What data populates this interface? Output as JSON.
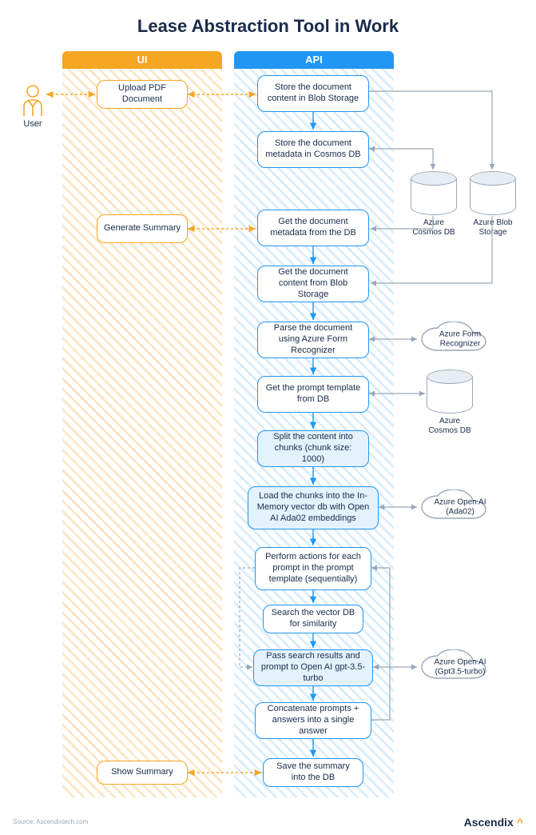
{
  "title": "Lease Abstraction Tool in Work",
  "lanes": {
    "ui": "UI",
    "api": "API"
  },
  "user_label": "User",
  "ui_nodes": {
    "upload": "Upload PDF Document",
    "generate": "Generate Summary",
    "show": "Show Summary"
  },
  "api_nodes": {
    "store_blob": "Store the document content in Blob Storage",
    "store_meta": "Store the document metadata in Cosmos DB",
    "get_meta": "Get the document metadata from the DB",
    "get_content": "Get the document content from Blob Storage",
    "parse": "Parse the document using Azure Form Recognizer",
    "get_prompt": "Get the prompt template from DB",
    "split": "Split the content into chunks (chunk size: 1000)",
    "load_vec": "Load the chunks into the In-Memory vector db with Open AI Ada02 embeddings",
    "perform": "Perform actions for each prompt in the prompt template (sequentially)",
    "search": "Search the vector DB for similarity",
    "pass": "Pass search results and prompt to Open AI gpt-3.5-turbo",
    "concat": "Concatenate prompts + answers into a single answer",
    "save": "Save the summary into the DB"
  },
  "externals": {
    "cosmos1": "Azure Cosmos DB",
    "blob1": "Azure Blob Storage",
    "form_rec": "Azure Form Recognizer",
    "cosmos2": "Azure Cosmos DB",
    "ada": "Azure Open AI (Ada02)",
    "gpt": "Azure Open AI (Gpt3.5-turbo)"
  },
  "footer": {
    "source": "Source: Ascendixtech.com",
    "brand": "Ascendix"
  }
}
